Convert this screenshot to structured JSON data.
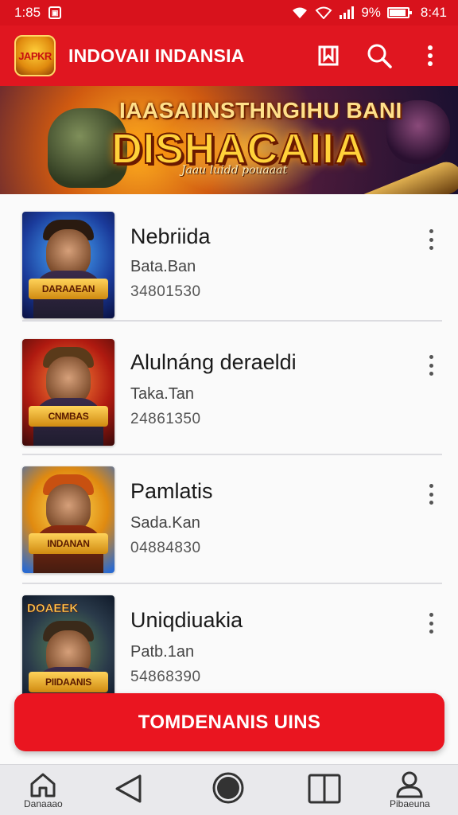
{
  "status_bar": {
    "time": "1:85",
    "battery_text": "9%",
    "battery_level": 0.9,
    "clock": "8:41",
    "icons": [
      "app-notification-icon",
      "wifi-icon",
      "wifi-icon",
      "signal-icon",
      "battery-icon"
    ]
  },
  "app_bar": {
    "logo_text": "JAPKR",
    "title": "INDOVAII INDANSIA",
    "actions": [
      "bookmark-icon",
      "search-icon",
      "more-vert-icon"
    ]
  },
  "banner": {
    "headline": "IAASAIINSTHNGIHU BANI",
    "big_text": "DISHACAIIA",
    "tagline": "Jaau luidd pouaaat"
  },
  "items": [
    {
      "title": "Nebriida",
      "subtitle": "Bata.Ban",
      "number": "34801530",
      "art_text": "DARAAEAN"
    },
    {
      "title": "Alulnáng deraeldi",
      "subtitle": "Taka.Tan",
      "number": "24861350",
      "art_text": "CNMBAS"
    },
    {
      "title": "Pamlatis",
      "subtitle": "Sada.Kan",
      "number": "04884830",
      "art_text": "INDANAN"
    },
    {
      "title": "Uniqdiuakia",
      "subtitle": "Patb.1an",
      "number": "54868390",
      "art_text": "PIIDAANIS",
      "art_top": "DOAEEK"
    }
  ],
  "cta": {
    "label": "TOMDENANIS UINS"
  },
  "bottom_nav": {
    "home_label": "Danaaao",
    "profile_label": "Pibaeuna"
  },
  "colors": {
    "primary": "#e01620",
    "status_bar": "#d8121c",
    "cta": "#ea1520"
  }
}
